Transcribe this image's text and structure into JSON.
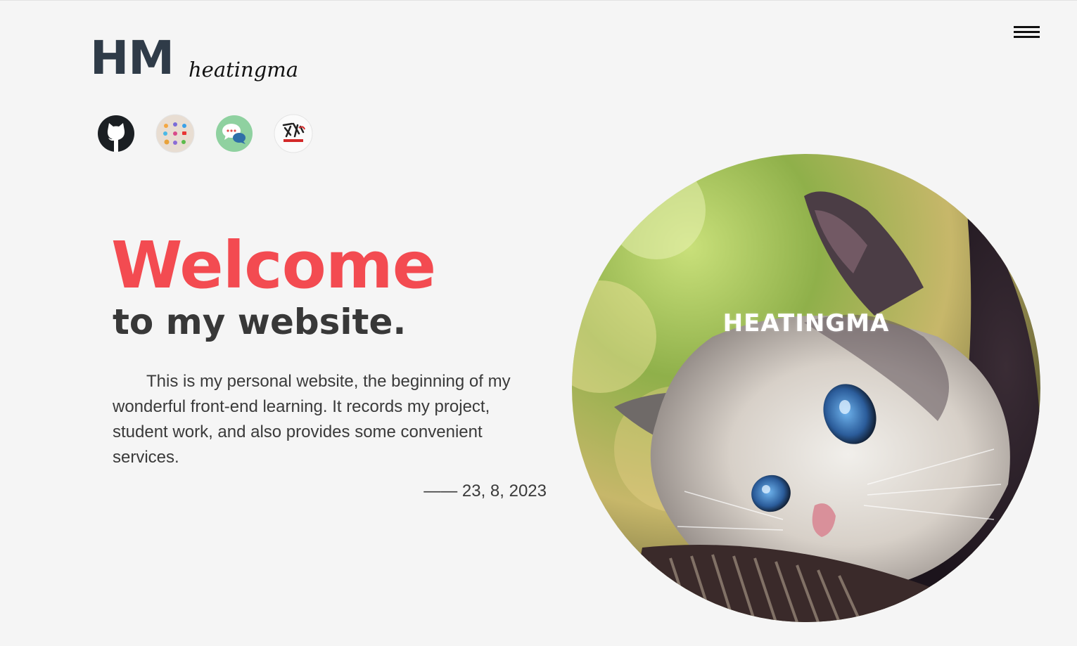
{
  "brand": {
    "mark": "HM",
    "name": "heatingma"
  },
  "nav": {
    "menu_icon": "hamburger-menu-icon"
  },
  "social_links": [
    {
      "icon": "github-icon"
    },
    {
      "icon": "apps-collection-icon"
    },
    {
      "icon": "chat-bubbles-icon"
    },
    {
      "icon": "calligraphy-logo-icon"
    }
  ],
  "hero": {
    "headline": "Welcome",
    "subheadline": "to my website.",
    "intro": "This is my personal website, the beginning of my wonderful front-end learning. It records my project, student work, and also provides some convenient services.",
    "signature": "—— 23, 8, 2023",
    "image_caption": "HEATINGMA",
    "image_subject": "cat-photo"
  },
  "colors": {
    "background": "#f5f5f5",
    "accent": "#f34b51",
    "heading": "#383838",
    "brand": "#2f3b48",
    "body_text": "#3a3a3a"
  }
}
